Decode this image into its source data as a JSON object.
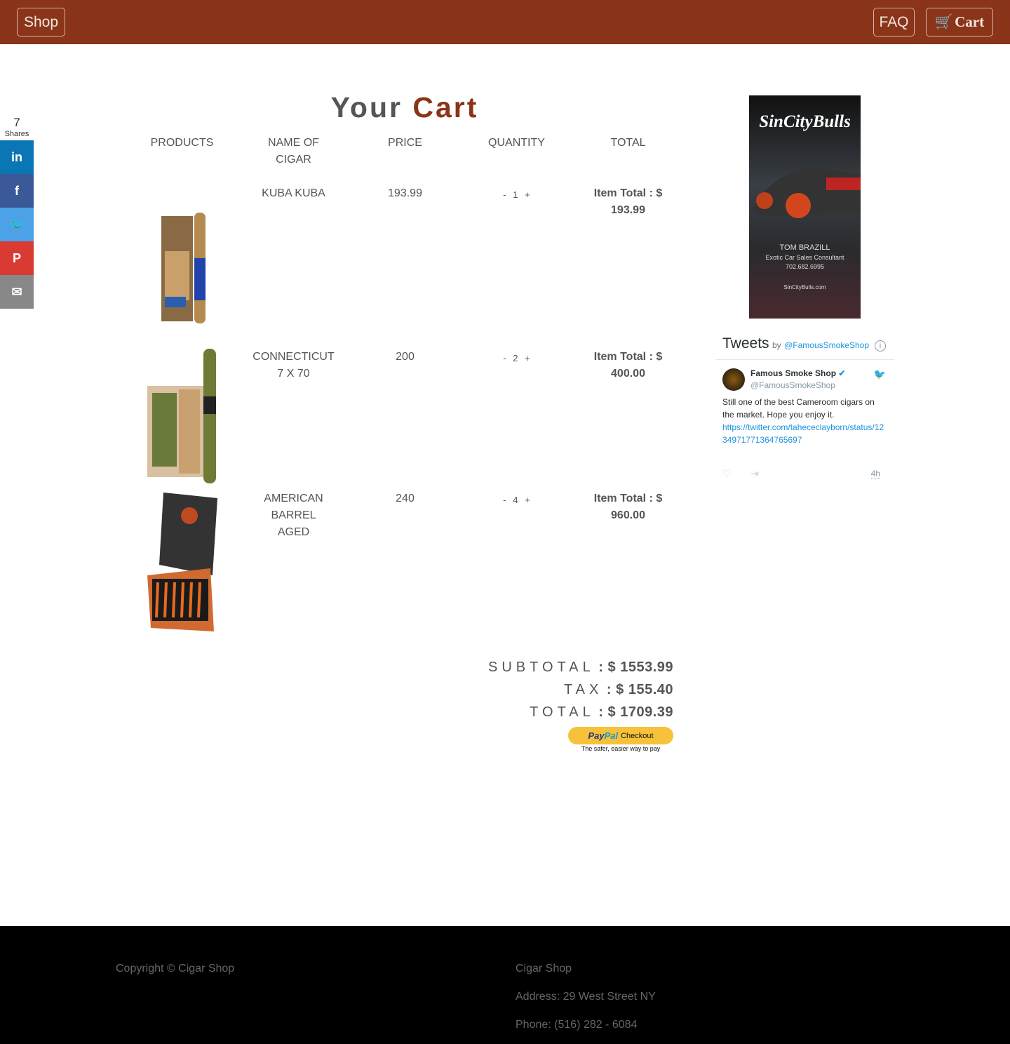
{
  "nav": {
    "shop": "Shop",
    "faq": "FAQ",
    "cart": "Cart"
  },
  "colors": {
    "brand": "#8a3419",
    "paypal": "#f7c139"
  },
  "share": {
    "count": "7",
    "label": "Shares",
    "buttons": [
      "linkedin",
      "facebook",
      "twitter",
      "pinterest",
      "email"
    ]
  },
  "cart": {
    "title_a": "Your",
    "title_b": "Cart",
    "headers": [
      "PRODUCTS",
      "NAME OF CIGAR",
      "PRICE",
      "QUANTITY",
      "TOTAL"
    ],
    "items": [
      {
        "name": "KUBA KUBA",
        "price": "193.99",
        "qty": "1",
        "total_label": "Item Total : $",
        "total": "193.99"
      },
      {
        "name": "CONNECTICUT 7 X 70",
        "price": "200",
        "qty": "2",
        "total_label": "Item Total : $",
        "total": "400.00"
      },
      {
        "name": "AMERICAN BARREL AGED",
        "price": "240",
        "qty": "4",
        "total_label": "Item Total : $",
        "total": "960.00"
      }
    ],
    "minus": "-",
    "plus": "+",
    "subtotal_label": "SUBTOTAL",
    "subtotal": ": $ 1553.99",
    "tax_label": "TAX",
    "tax": ": $ 155.40",
    "total_label": "TOTAL",
    "total": ": $ 1709.39",
    "paypal": {
      "pay": "Pay",
      "pal": "Pal",
      "checkout": "Checkout",
      "tagline": "The safer, easier way to pay"
    }
  },
  "ad": {
    "brand": "SinCityBulls",
    "name": "TOM BRAZILL",
    "role": "Exotic Car Sales Consultant",
    "phone": "702.682.6995",
    "site": "SinCityBulls.com"
  },
  "tweets": {
    "title": "Tweets",
    "by": "by",
    "handle_link": "@FamousSmokeShop",
    "author": "Famous Smoke Shop",
    "handle": "@FamousSmokeShop",
    "text": "Still one of the best Cameroom cigars on the market. Hope you enjoy it.",
    "link": "https://twitter.com/tahececlayborn/status/1234971771364765697",
    "time": "4h"
  },
  "footer": {
    "copyright": "Copyright © Cigar Shop",
    "name": "Cigar Shop",
    "address": "Address: 29 West Street NY",
    "phone": "Phone: (516) 282 - 6084"
  }
}
